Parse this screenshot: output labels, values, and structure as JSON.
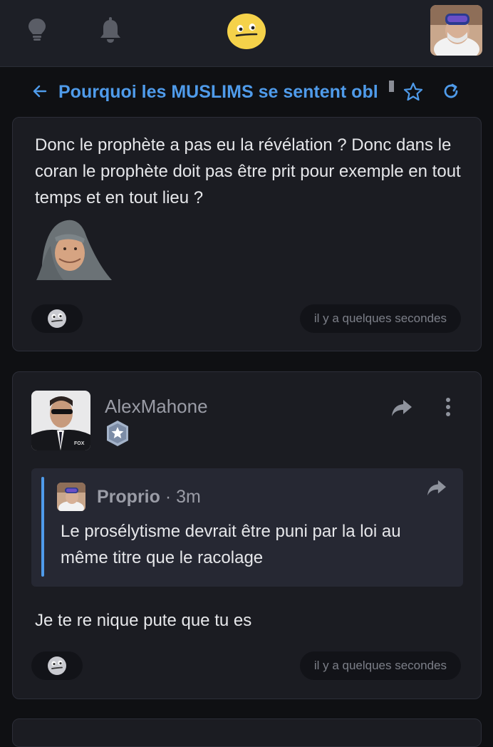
{
  "header": {
    "icons": [
      "lightbulb-icon",
      "bell-icon",
      "smiley-logo-icon",
      "user-avatar"
    ]
  },
  "thread": {
    "title": "Pourquoi les MUSLIMS se sentent obl",
    "icons": [
      "back-arrow-icon",
      "star-icon",
      "refresh-icon"
    ],
    "accent_color": "#4f9bea"
  },
  "posts": [
    {
      "text": "Donc le prophète a pas eu la révélation ? Donc dans le coran le prophète doit pas être prit pour exemple en tout temps et en tout lieu ?",
      "time": "il y a quelques secondes"
    },
    {
      "author": "AlexMahone",
      "quote": {
        "author": "Proprio",
        "separator": "·",
        "time": "3m",
        "text": "Le prosélytisme devrait être puni par la loi au même titre que le racolage"
      },
      "text": "Je te re nique pute que tu es",
      "time": "il y a quelques secondes"
    }
  ]
}
